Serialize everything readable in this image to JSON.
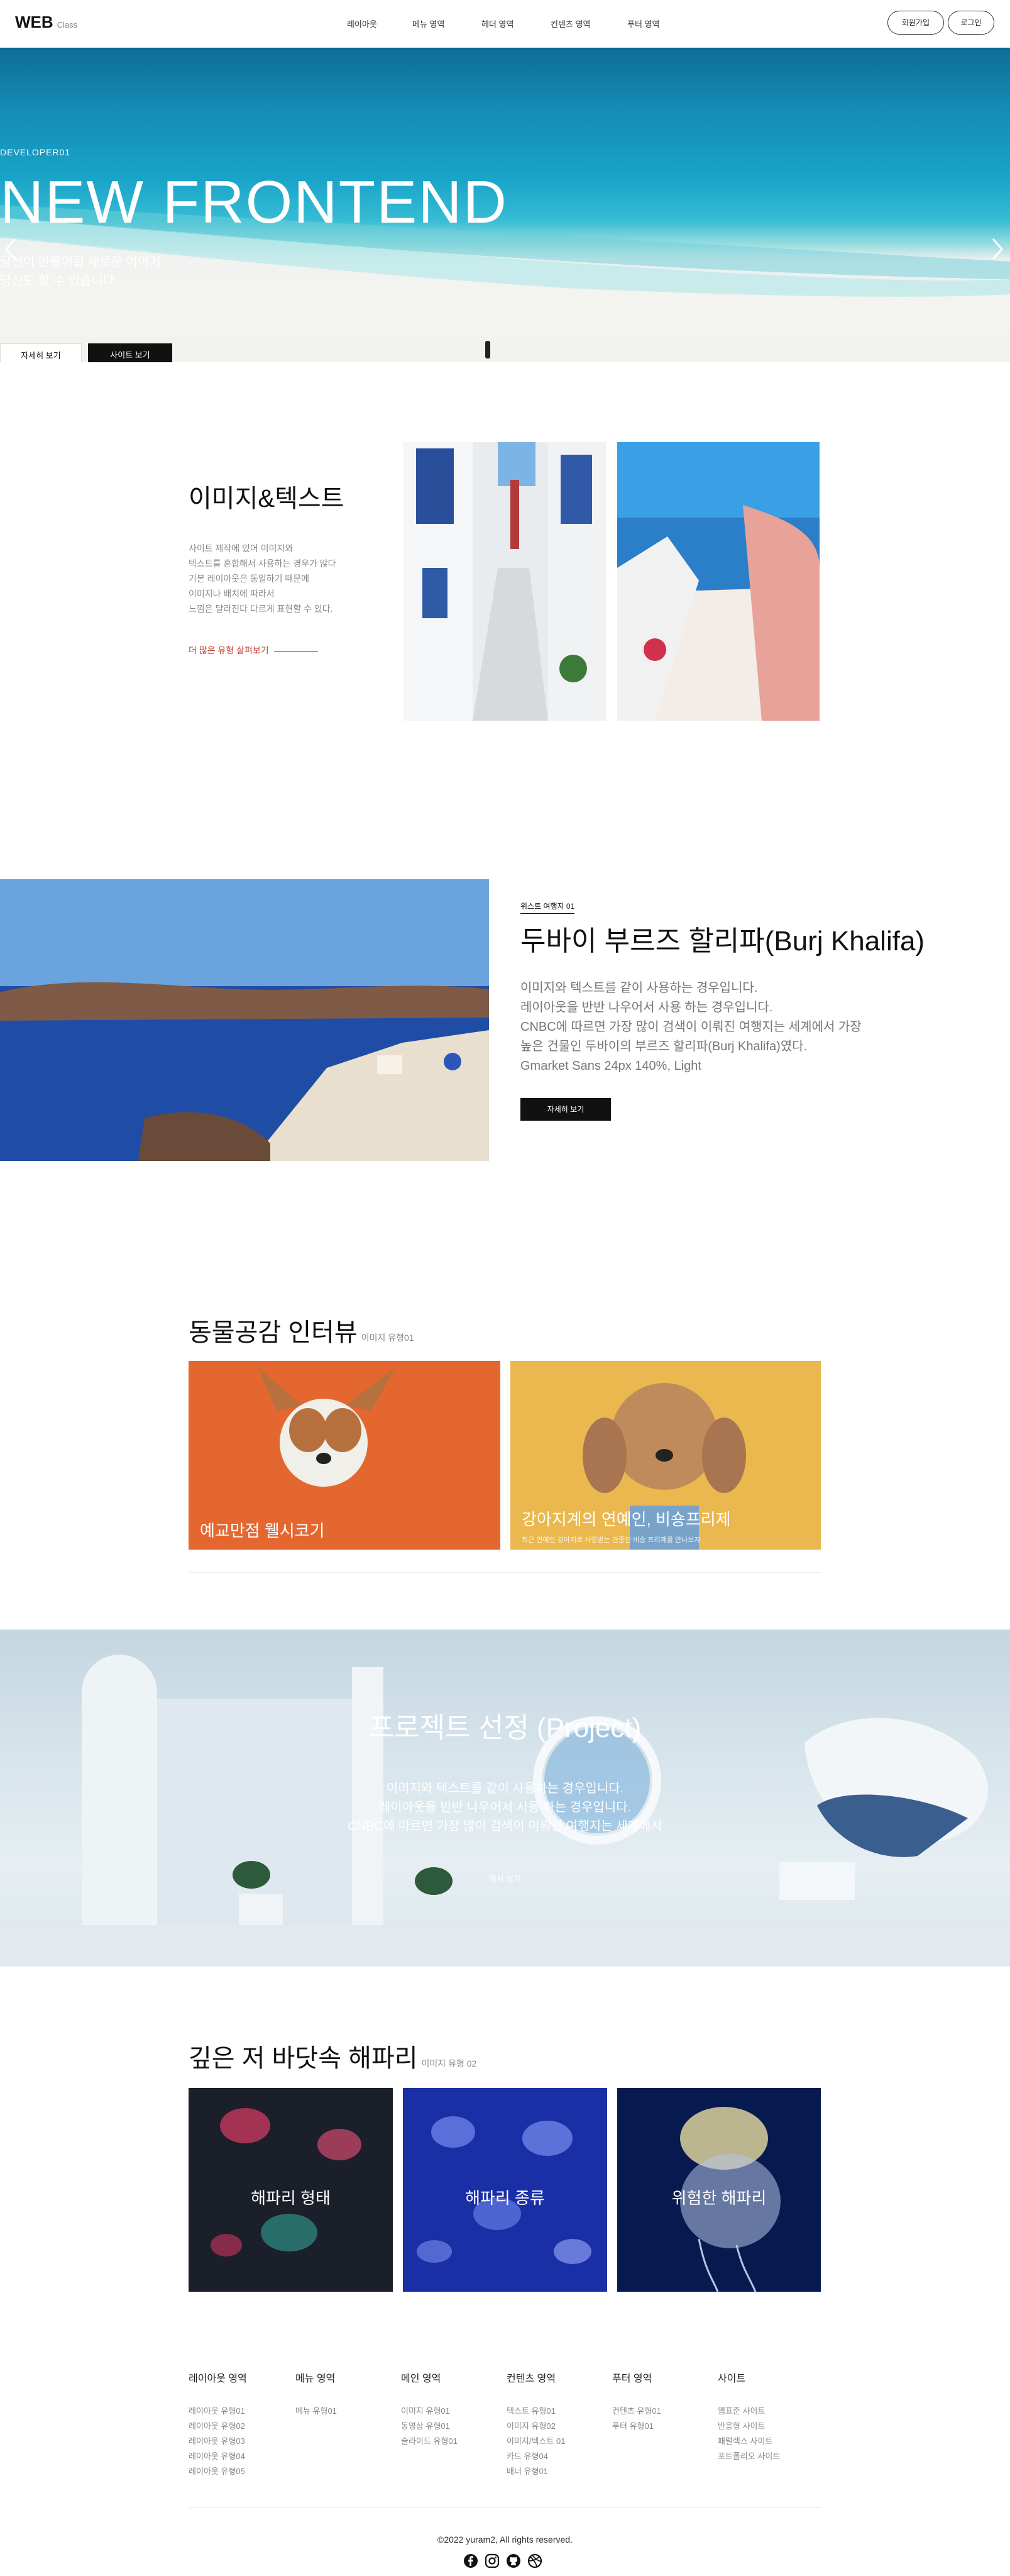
{
  "header": {
    "logo": "WEB",
    "logo_sub": "Class",
    "nav": [
      "레이아웃",
      "메뉴 영역",
      "헤더 영역",
      "컨텐츠 영역",
      "푸터 영역"
    ],
    "signup": "회원가입",
    "login": "로그인"
  },
  "hero": {
    "sub": "DEVELOPER01",
    "title": "NEW FRONTEND",
    "desc1": "당신이 만들어갈 새로운 이야기",
    "desc2": "당신도 할 수 있습니다.",
    "btn_more": "자세히 보기",
    "btn_site": "사이트 보기",
    "prev_icon": "chevron-left-icon",
    "next_icon": "chevron-right-icon",
    "slide_count": 3,
    "active_slide": 1
  },
  "imagetext": {
    "title": "이미지&텍스트",
    "desc": [
      "사이트 제작에 있어 이미지와",
      "텍스트를 혼합해서 사용하는 경우가 많다",
      "기본 레이아웃은 동일하기 때문에",
      "이미지나 배치에 따라서",
      "느낌은 달라진다 다르게 표현할 수 있다."
    ],
    "more": "더 많은 유형 살펴보기"
  },
  "burj": {
    "badge": "위스트 여행지 01",
    "title": "두바이 부르즈 할리파(Burj Khalifa)",
    "desc": [
      "이미지와 텍스트를 같이 사용하는 경우입니다.",
      "레이아웃을 반반 나우어서 사용 하는 경우입니다.",
      "CNBC에 따르면 가장 많이 검색이 이뤄진 여행지는 세계에서 가장",
      "높은 건물인 두바이의 부르즈 할리파(Burj Khalifa)였다.",
      "Gmarket Sans 24px 140%, Light"
    ],
    "btn": "자세히 보기"
  },
  "animals": {
    "title": "동물공감 인터뷰",
    "sub": "이미지 유형01",
    "cards": [
      {
        "caption": "예교만점 웰시코기",
        "small": ""
      },
      {
        "caption": "강아지계의 연예인, 비숑프리제",
        "small": "최근 연예인 강아지로 사랑받는 견종인 비숑 프리제를 만나보자"
      }
    ]
  },
  "project": {
    "title": "프로젝트 선정 (Project)",
    "desc": [
      "이미지와 텍스트를 같이 사용하는 경우입니다.",
      "레이아웃을 반반 나우어서 사용 하는 경우입니다.",
      "CNBC에 따르면 가장 많이 검색이 이뤄진 여행지는 세계에서"
    ],
    "btn": "예시 보기"
  },
  "jelly": {
    "title": "깊은 저 바닷속 해파리",
    "sub": "이미지 유형 02",
    "cards": [
      "해파리 형태",
      "해파리 종류",
      "위험한 해파리"
    ]
  },
  "footer": {
    "columns": [
      {
        "title": "레이아웃 영역",
        "items": [
          "레이아웃 유형01",
          "레이아웃 유형02",
          "레이아웃 유형03",
          "레이아웃 유형04",
          "레이아웃 유형05"
        ]
      },
      {
        "title": "메뉴 영역",
        "items": [
          "메뉴 유형01"
        ]
      },
      {
        "title": "메인 영역",
        "items": [
          "이미지 유형01",
          "동영상 유형01",
          "슬라이드 유형01"
        ]
      },
      {
        "title": "컨텐츠 영역",
        "items": [
          "텍스트 유형01",
          "이미지 유형02",
          "이미지/텍스트 01",
          "카드 유형04",
          "배너 유형01"
        ]
      },
      {
        "title": "푸터 영역",
        "items": [
          "컨텐츠 유형01",
          "푸터 유형01"
        ]
      },
      {
        "title": "사이트",
        "items": [
          "웹표준 사이트",
          "반응형 사이트",
          "패럴렉스 사이트",
          "포트폴리오 사이트"
        ]
      }
    ],
    "copyright": "©2022 yuram2, All rights reserved.",
    "social": [
      "facebook-icon",
      "instagram-icon",
      "github-icon",
      "dribbble-icon"
    ]
  },
  "colors": {
    "accent_link": "#c0392b",
    "dark": "#111111"
  }
}
